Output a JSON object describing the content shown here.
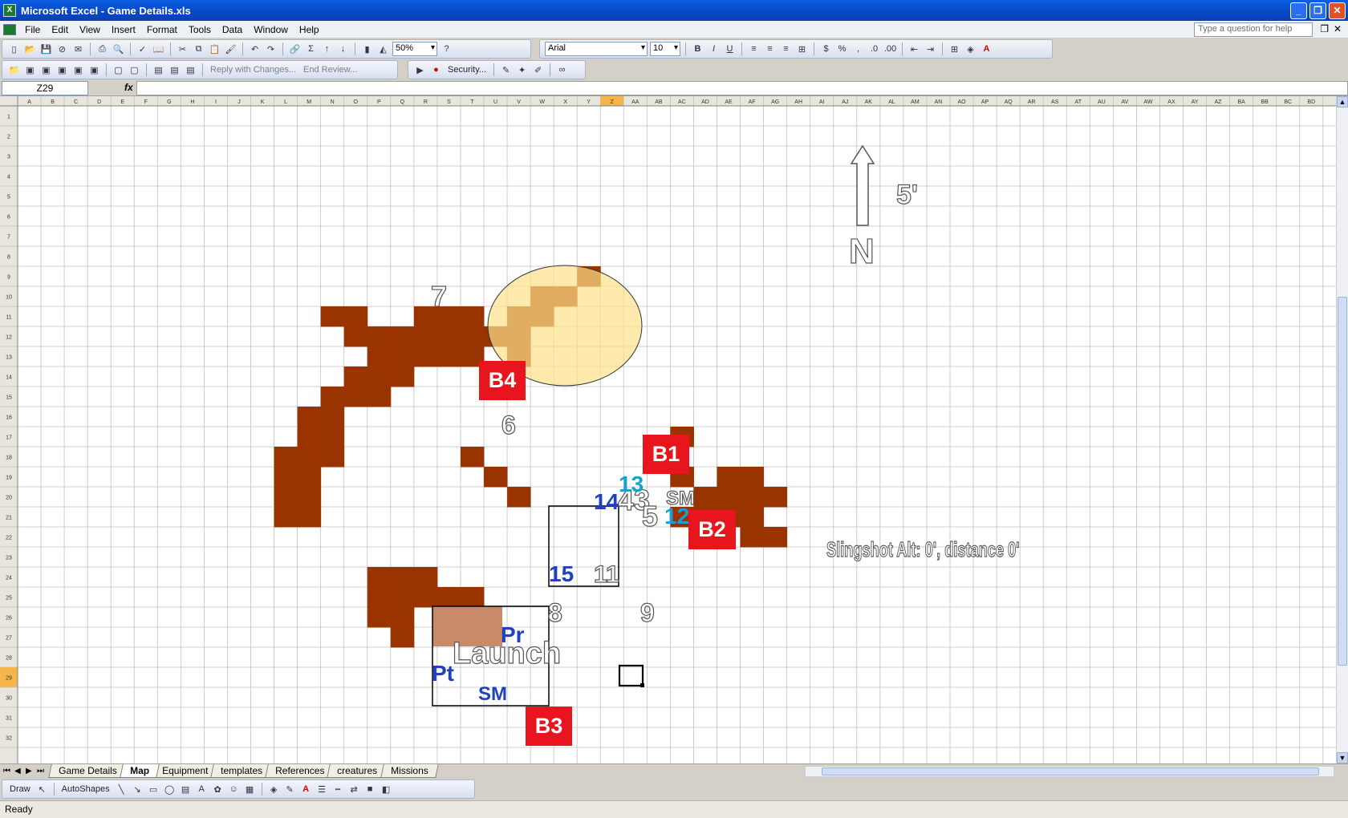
{
  "window": {
    "title": "Microsoft Excel - Game Details.xls",
    "app_icon": "excel-icon",
    "min": "_",
    "max": "❐",
    "close": "✕"
  },
  "menu": {
    "items": [
      "File",
      "Edit",
      "View",
      "Insert",
      "Format",
      "Tools",
      "Data",
      "Window",
      "Help"
    ],
    "help_placeholder": "Type a question for help"
  },
  "toolbar": {
    "zoom": "50%",
    "font": "Arial",
    "size": "10",
    "reply_label": "Reply with Changes...",
    "end_review_label": "End Review...",
    "security_label": "Security..."
  },
  "formula": {
    "namebox": "Z29",
    "fx": "fx",
    "value": ""
  },
  "grid": {
    "columns": [
      "A",
      "B",
      "C",
      "D",
      "E",
      "F",
      "G",
      "H",
      "I",
      "J",
      "K",
      "L",
      "M",
      "N",
      "O",
      "P",
      "Q",
      "R",
      "S",
      "T",
      "U",
      "V",
      "W",
      "X",
      "Y",
      "Z",
      "AA",
      "AB",
      "AC",
      "AD",
      "AE",
      "AF",
      "AG",
      "AH",
      "AI",
      "AJ",
      "AK",
      "AL",
      "AM",
      "AN",
      "AO",
      "AP",
      "AQ",
      "AR",
      "AS",
      "AT",
      "AU",
      "AV",
      "AW",
      "AX",
      "AY",
      "AZ",
      "BA",
      "BB",
      "BC",
      "BD"
    ],
    "row_count": 32,
    "selected_col": "Z",
    "selected_row": 29
  },
  "map": {
    "north_label": "N",
    "scale_label": "5'",
    "slingshot_text": "Slingshot Alt: 0', distance 0'",
    "launch_label": "Launch",
    "b1": "B1",
    "b2": "B2",
    "b3": "B3",
    "b4": "B4",
    "n6": "6",
    "n7": "7",
    "n8": "8",
    "n9": "9",
    "n11": "11",
    "n12": "12",
    "n13": "13",
    "n14": "14",
    "n15": "15",
    "n43": "43",
    "n5": "5",
    "sm_top": "SM",
    "sm_bottom": "SM",
    "pr": "Pr",
    "pt": "Pt",
    "terrain_color": "#993300",
    "marker_color": "#e8141e",
    "blue_label_color": "#2040c0",
    "cyan_label_color": "#1aa0d0"
  },
  "tabs": {
    "items": [
      "Game Details",
      "Map",
      "Equipment",
      "templates",
      "References",
      "creatures",
      "Missions"
    ],
    "active": "Map"
  },
  "drawbar": {
    "draw": "Draw",
    "autoshapes": "AutoShapes"
  },
  "status": {
    "text": "Ready"
  }
}
